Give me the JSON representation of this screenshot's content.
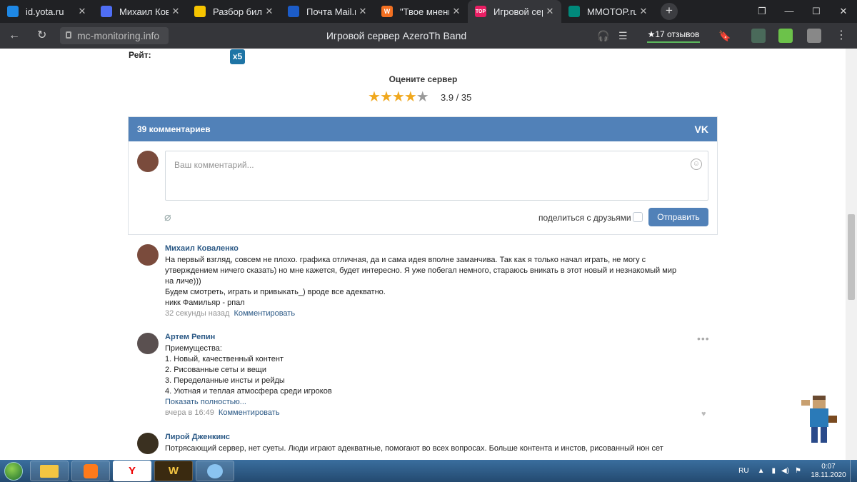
{
  "browser": {
    "tabs": [
      {
        "label": "id.yota.ru",
        "icon_color": "#1e88e5",
        "icon": "yota-icon"
      },
      {
        "label": "Михаил Коваленко",
        "icon_color": "#4f6ef5",
        "icon": "pause-icon"
      },
      {
        "label": "Разбор билетов",
        "icon_color": "#f6c400",
        "icon": "play-icon"
      },
      {
        "label": "Почта Mail.ru",
        "icon_color": "#1c5cc8",
        "icon": "mail-icon"
      },
      {
        "label": "\"Твое мнение\"",
        "icon_color": "#f37021",
        "icon": "w-icon"
      },
      {
        "label": "Игровой сервер",
        "icon_color": "#e91e63",
        "icon": "top-icon",
        "active": true
      },
      {
        "label": "MMOTOP.ru",
        "icon_color": "#00897b",
        "icon": "mmotop-icon"
      }
    ],
    "url": "mc-monitoring.info",
    "page_title": "Игровой сервер AzeroTh Band",
    "reviews": "★17 отзывов",
    "tab_icon_text": {
      "top": "TOP",
      "w": "W"
    }
  },
  "rate": {
    "label": "Рейт:",
    "value": "x5"
  },
  "rating": {
    "title": "Оцените сервер",
    "score": "3.9 / 35",
    "stars_filled": 4,
    "stars_total": 5
  },
  "vk": {
    "header": "39 комментариев",
    "logo": "VK",
    "placeholder": "Ваш комментарий...",
    "share_label": "поделиться с друзьями",
    "send_label": "Отправить"
  },
  "comments": [
    {
      "author": "Михаил Коваленко",
      "lines": [
        "На первый взгляд, совсем не плохо. графика отличная, да и сама идея вполне заманчива. Так как я только начал играть, не могу с утверждением ничего сказать) но мне кажется, будет интересно. Я уже побегал немного, стараюсь вникать в этот новый и незнакомый мир на личе)))",
        "Будем смотреть, играть и привыкать_) вроде все адекватно.",
        "никк Фамильяр - рпал"
      ],
      "time": "32 секунды назад",
      "reply": "Комментировать"
    },
    {
      "author": "Артем Репин",
      "lines": [
        "Приемущества:",
        "1. Новый, качественный контент",
        "2. Рисованные сеты и вещи",
        "3. Переделанные инсты и рейды",
        "4. Уютная и теплая атмосфера среди игроков"
      ],
      "more": "Показать полностью...",
      "time": "вчера в 16:49",
      "reply": "Комментировать"
    },
    {
      "author": "Лирой Дженкинс",
      "lines": [
        "Потрясающий сервер, нет суеты. Люди играют адекватные, помогают во всех вопросах. Больше контента и инстов, рисованный нон сет"
      ]
    }
  ],
  "taskbar": {
    "lang": "RU",
    "time": "0:07",
    "date": "18.11.2020",
    "yandex": "Y",
    "wow": "W"
  }
}
